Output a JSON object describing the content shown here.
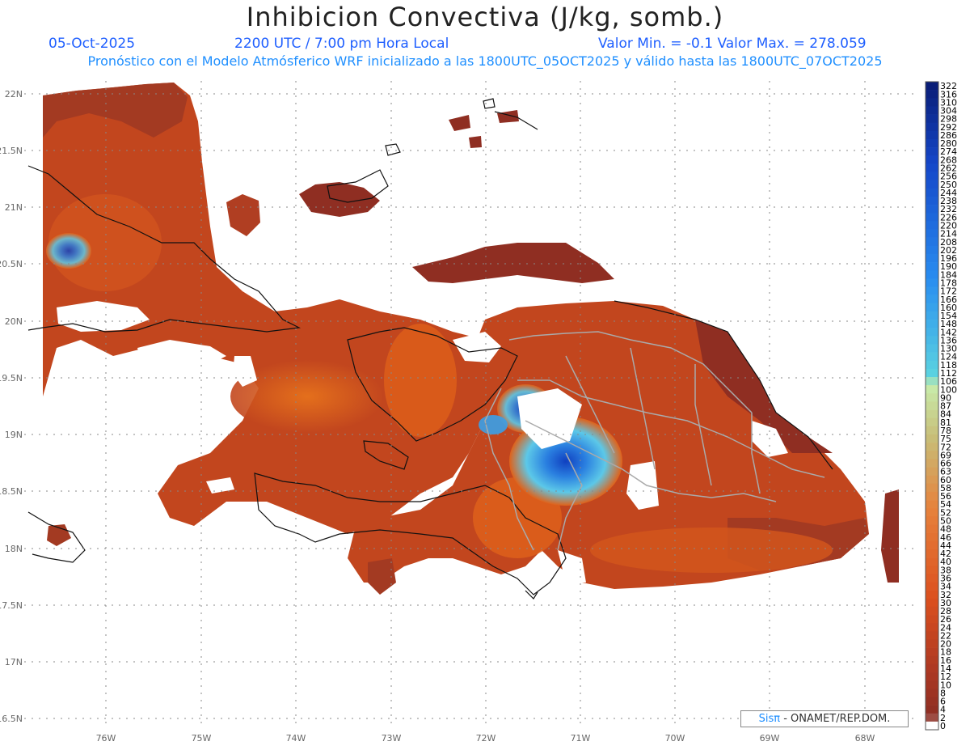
{
  "header": {
    "title": "Inhibicion Convectiva (J/kg, somb.)",
    "date": "05-Oct-2025",
    "time": "2200 UTC / 7:00 pm Hora Local",
    "minmax": "Valor Min. = -0.1  Valor Max. = 278.059",
    "subtitle": "Pronóstico con el Modelo Atmósferico WRF inicializado a las 1800UTC_05OCT2025 y válido hasta las  1800UTC_07OCT2025"
  },
  "axes": {
    "lat_labels": [
      "22N",
      "21.5N",
      "21N",
      "20.5N",
      "20N",
      "19.5N",
      "19N",
      "18.5N",
      "18N",
      "17.5N",
      "17N",
      "16.5N"
    ],
    "lon_labels": [
      "76W",
      "75W",
      "74W",
      "73W",
      "72W",
      "71W",
      "70W",
      "69W",
      "68W"
    ]
  },
  "colorbar": {
    "labels": [
      "322",
      "316",
      "310",
      "304",
      "298",
      "292",
      "286",
      "280",
      "274",
      "268",
      "262",
      "256",
      "250",
      "244",
      "238",
      "232",
      "226",
      "220",
      "214",
      "208",
      "202",
      "196",
      "190",
      "184",
      "178",
      "172",
      "166",
      "160",
      "154",
      "148",
      "142",
      "136",
      "130",
      "124",
      "118",
      "112",
      "106",
      "100",
      "90",
      "87",
      "84",
      "81",
      "78",
      "75",
      "72",
      "69",
      "66",
      "63",
      "60",
      "58",
      "56",
      "54",
      "52",
      "50",
      "48",
      "46",
      "44",
      "42",
      "40",
      "38",
      "36",
      "34",
      "32",
      "30",
      "28",
      "26",
      "24",
      "22",
      "20",
      "18",
      "16",
      "14",
      "12",
      "10",
      "8",
      "6",
      "4",
      "2",
      "0"
    ]
  },
  "credit": {
    "brand": "Sisπ",
    "text": " - ONAMET/REP.DOM."
  },
  "colors": {
    "field_main": "#c2461e",
    "field_dark": "#8f2e22",
    "field_orange": "#e0621a",
    "field_blue": "#3aa0e8",
    "field_deep_blue": "#1040c0",
    "title_blue": "#1f5fff",
    "subtitle_blue": "#1f8fff"
  }
}
